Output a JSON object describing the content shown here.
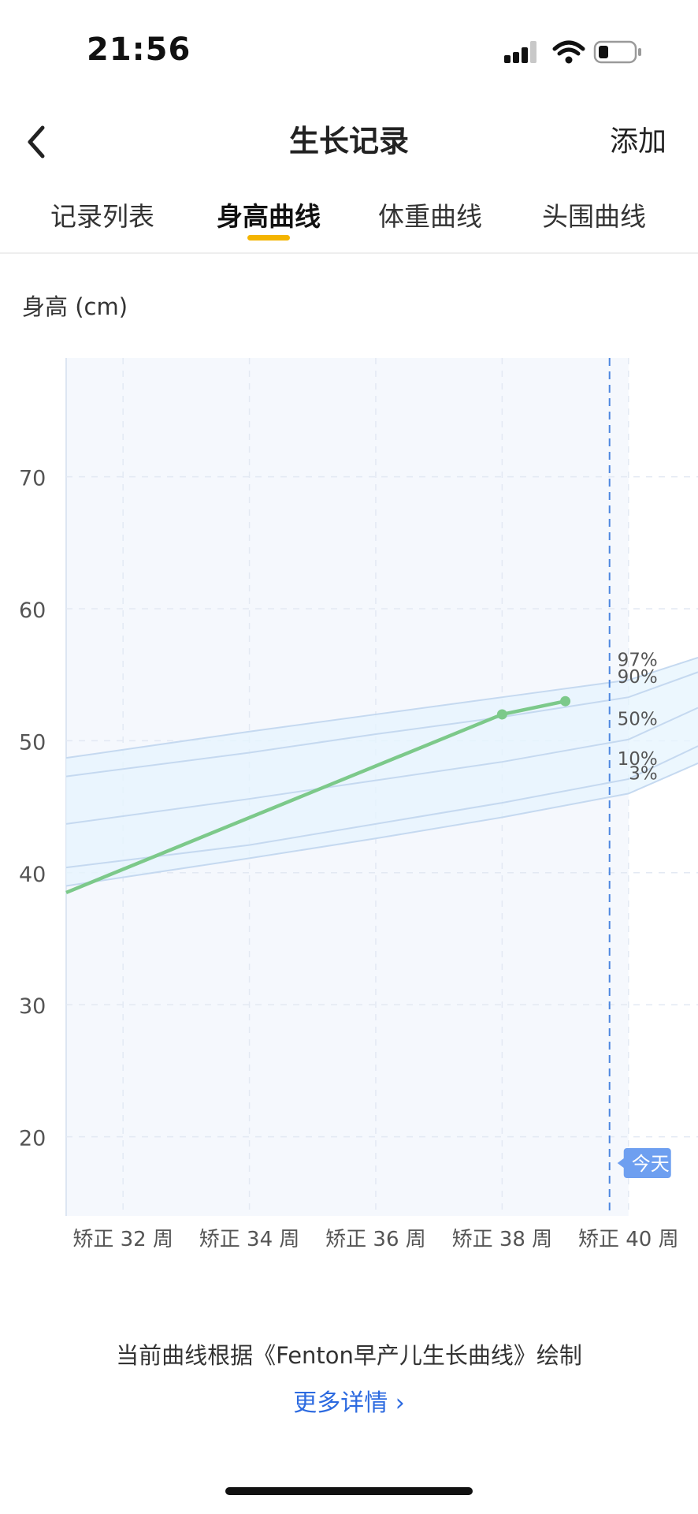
{
  "status_bar": {
    "time": "21:56",
    "signal_icon": "cellular-signal-icon",
    "wifi_icon": "wifi-icon",
    "battery_icon": "battery-low-icon"
  },
  "nav": {
    "title": "生长记录",
    "back_icon": "chevron-left-icon",
    "add_label": "添加"
  },
  "tabs": [
    {
      "label": "记录列表",
      "active": false
    },
    {
      "label": "身高曲线",
      "active": true
    },
    {
      "label": "体重曲线",
      "active": false
    },
    {
      "label": "头围曲线",
      "active": false
    }
  ],
  "colors": {
    "accent_underline": "#f4b400",
    "measured_line": "#7cc98a",
    "percentile_lines": "#c5d9f0",
    "today_line": "#4d87e0",
    "today_badge": "#6e9ff0",
    "link": "#2c6ae0"
  },
  "chart_data": {
    "type": "line",
    "ylabel": "身高 (cm)",
    "y_ticks": [
      20,
      30,
      40,
      50,
      60,
      70
    ],
    "ylim": [
      14,
      79
    ],
    "x_ticks": [
      32,
      34,
      36,
      38,
      40
    ],
    "x_tick_labels": [
      "矫正 32 周",
      "矫正 34 周",
      "矫正 36 周",
      "矫正 38 周",
      "矫正 40 周"
    ],
    "xlim": [
      31.1,
      41.1
    ],
    "grid": true,
    "shaded_until_week": 40,
    "percentile_series": [
      {
        "name": "97%",
        "x": [
          31.1,
          34,
          36,
          38,
          40,
          41.1
        ],
        "values": [
          48.7,
          50.7,
          52.0,
          53.3,
          54.6,
          56.3
        ]
      },
      {
        "name": "90%",
        "x": [
          31.1,
          34,
          36,
          38,
          40,
          41.1
        ],
        "values": [
          47.3,
          49.1,
          50.5,
          51.8,
          53.3,
          55.2
        ]
      },
      {
        "name": "50%",
        "x": [
          31.1,
          34,
          36,
          38,
          40,
          41.1
        ],
        "values": [
          43.7,
          45.6,
          47.0,
          48.4,
          50.1,
          52.5
        ]
      },
      {
        "name": "10%",
        "x": [
          31.1,
          34,
          36,
          38,
          40,
          41.1
        ],
        "values": [
          40.4,
          42.1,
          43.7,
          45.3,
          47.1,
          49.6
        ]
      },
      {
        "name": "3%",
        "x": [
          31.1,
          34,
          36,
          38,
          40,
          41.1
        ],
        "values": [
          39.0,
          41.1,
          42.6,
          44.2,
          46.0,
          48.3
        ]
      }
    ],
    "measurements": [
      {
        "x": 31.1,
        "y": 38.5,
        "marker": false
      },
      {
        "x": 38.0,
        "y": 52.0,
        "marker": true
      },
      {
        "x": 39.0,
        "y": 53.0,
        "marker": true
      }
    ],
    "today": {
      "label": "今天",
      "week": 39.7
    }
  },
  "footer": {
    "note": "当前曲线根据《Fenton早产儿生长曲线》绘制",
    "more_label": "更多详情 ›"
  }
}
